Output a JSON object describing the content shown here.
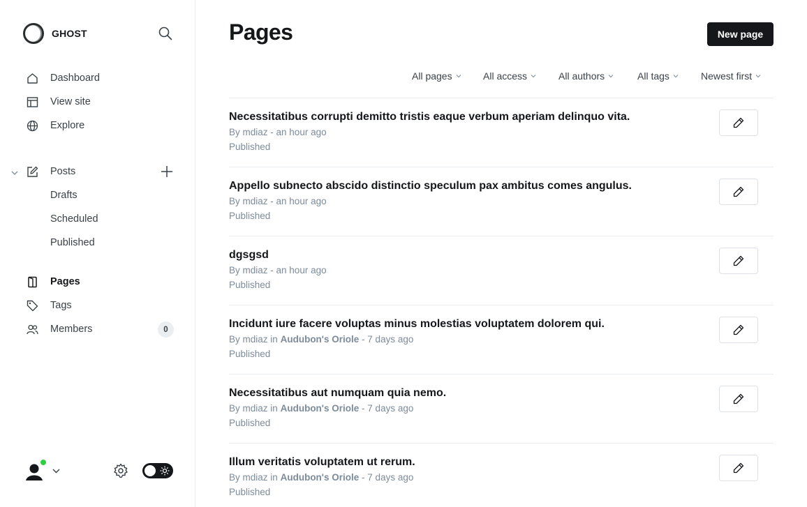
{
  "sidebar": {
    "brand": "GHOST",
    "nav": [
      {
        "label": "Dashboard",
        "icon": "home-icon"
      },
      {
        "label": "View site",
        "icon": "view-site-icon"
      },
      {
        "label": "Explore",
        "icon": "globe-icon"
      }
    ],
    "posts": {
      "label": "Posts",
      "sub": [
        "Drafts",
        "Scheduled",
        "Published"
      ]
    },
    "nav2": [
      {
        "label": "Pages",
        "icon": "pages-icon",
        "active": true
      },
      {
        "label": "Tags",
        "icon": "tag-icon"
      },
      {
        "label": "Members",
        "icon": "members-icon"
      }
    ],
    "members_count": "0",
    "colors": {
      "online": "#30cf43",
      "toggle": "#15171a"
    }
  },
  "main": {
    "title": "Pages",
    "new_button": "New page",
    "filters": [
      "All pages",
      "All access",
      "All authors",
      "All tags",
      "Newest first"
    ],
    "rows": [
      {
        "title": "Necessitatibus corrupti demitto tristis eaque verbum aperiam delinquo vita.",
        "by": "By mdiaz",
        "in": "",
        "tag": "",
        "time": "an hour ago",
        "status": "Published"
      },
      {
        "title": "Appello subnecto abscido distinctio speculum pax ambitus comes angulus.",
        "by": "By mdiaz",
        "in": "",
        "tag": "",
        "time": "an hour ago",
        "status": "Published"
      },
      {
        "title": "dgsgsd",
        "by": "By mdiaz",
        "in": "",
        "tag": "",
        "time": "an hour ago",
        "status": "Published"
      },
      {
        "title": "Incidunt iure facere voluptas minus molestias voluptatem dolorem qui.",
        "by": "By mdiaz",
        "in": "in",
        "tag": "Audubon's Oriole",
        "time": "7 days ago",
        "status": "Published"
      },
      {
        "title": "Necessitatibus aut numquam quia nemo.",
        "by": "By mdiaz",
        "in": "in",
        "tag": "Audubon's Oriole",
        "time": "7 days ago",
        "status": "Published"
      },
      {
        "title": "Illum veritatis voluptatem ut rerum.",
        "by": "By mdiaz",
        "in": "in",
        "tag": "Audubon's Oriole",
        "time": "7 days ago",
        "status": "Published"
      }
    ]
  }
}
